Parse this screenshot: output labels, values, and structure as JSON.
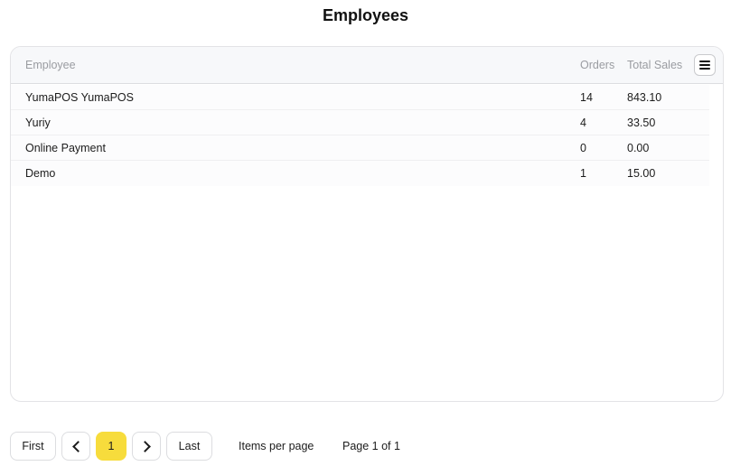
{
  "page": {
    "title": "Employees"
  },
  "table": {
    "columns": {
      "employee": "Employee",
      "orders": "Orders",
      "total_sales": "Total Sales"
    },
    "menu_icon": "hamburger-menu-icon",
    "rows": [
      {
        "employee": "YumaPOS YumaPOS",
        "orders": "14",
        "total_sales": "843.10"
      },
      {
        "employee": "Yuriy",
        "orders": "4",
        "total_sales": "33.50"
      },
      {
        "employee": "Online Payment",
        "orders": "0",
        "total_sales": "0.00"
      },
      {
        "employee": "Demo",
        "orders": "1",
        "total_sales": "15.00"
      }
    ]
  },
  "pagination": {
    "first_label": "First",
    "prev_icon": "chevron-left-icon",
    "current_page": "1",
    "next_icon": "chevron-right-icon",
    "last_label": "Last",
    "items_per_page_label": "Items per page",
    "page_info": "Page 1 of 1",
    "accent_color": "#f7dc3c"
  }
}
